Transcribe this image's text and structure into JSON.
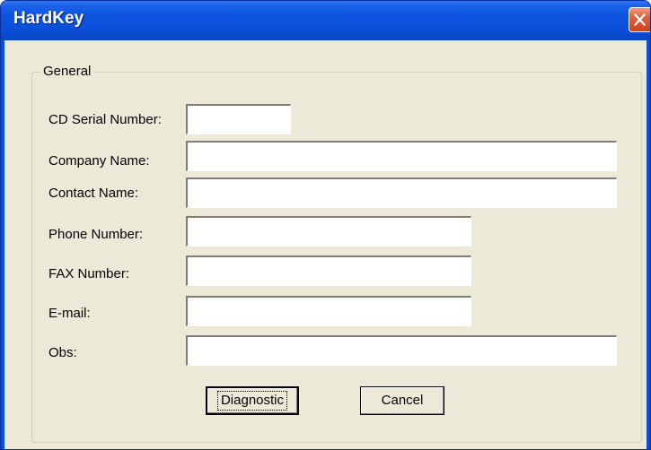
{
  "window": {
    "title": "HardKey"
  },
  "group": {
    "legend": "General"
  },
  "fields": {
    "cd_serial": {
      "label": "CD Serial Number:",
      "value": ""
    },
    "company_name": {
      "label": "Company Name:",
      "value": ""
    },
    "contact_name": {
      "label": "Contact Name:",
      "value": ""
    },
    "phone_number": {
      "label": "Phone Number:",
      "value": ""
    },
    "fax_number": {
      "label": "FAX Number:",
      "value": ""
    },
    "email": {
      "label": "E-mail:",
      "value": ""
    },
    "obs": {
      "label": "Obs:",
      "value": ""
    }
  },
  "buttons": {
    "diagnostic": "Diagnostic",
    "cancel": "Cancel"
  },
  "icons": {
    "close": "close-icon"
  },
  "colors": {
    "titlebar": "#0a4fd8",
    "client_background": "#ece9d8",
    "close_button": "#e0603e"
  }
}
